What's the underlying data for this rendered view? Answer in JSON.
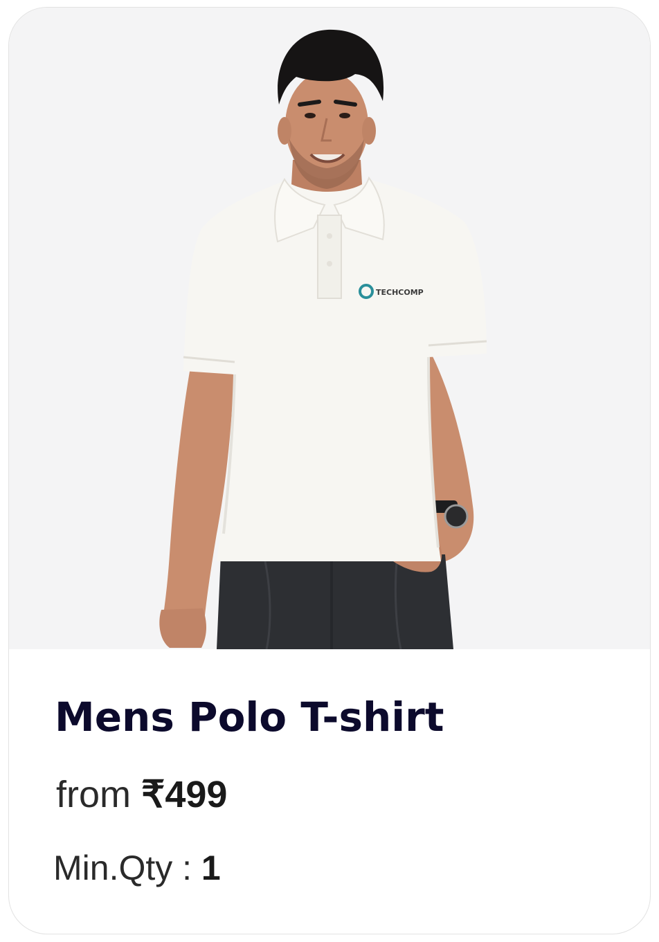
{
  "product": {
    "image_alt": "Man wearing white polo t-shirt with company logo",
    "logo_text": "TECHCOMP",
    "name": "Mens Polo T-shirt",
    "price_prefix": "from",
    "price": "₹499",
    "min_qty_label": "Min.Qty : ",
    "min_qty_value": "1"
  },
  "colors": {
    "card_border": "#e2e2e2",
    "image_background": "#f4f4f5",
    "title": "#0c0a2c",
    "body_text": "#2a2a2a",
    "logo_accent": "#2a8f9a"
  }
}
